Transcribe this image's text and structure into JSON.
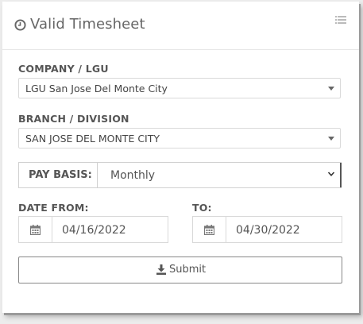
{
  "header": {
    "title": "Valid Timesheet",
    "icon": "clock-icon",
    "menu_icon": "list-icon"
  },
  "form": {
    "company": {
      "label": "COMPANY / LGU",
      "value": "LGU San Jose Del Monte City"
    },
    "branch": {
      "label": "BRANCH / DIVISION",
      "value": "SAN JOSE DEL MONTE CITY"
    },
    "pay_basis": {
      "label": "PAY BASIS:",
      "value": "Monthly"
    },
    "date_from": {
      "label": "DATE FROM:",
      "value": "04/16/2022",
      "icon": "calendar-icon"
    },
    "date_to": {
      "label": "TO:",
      "value": "04/30/2022",
      "icon": "calendar-icon"
    },
    "submit": {
      "label": "Submit",
      "icon": "download-icon"
    }
  }
}
